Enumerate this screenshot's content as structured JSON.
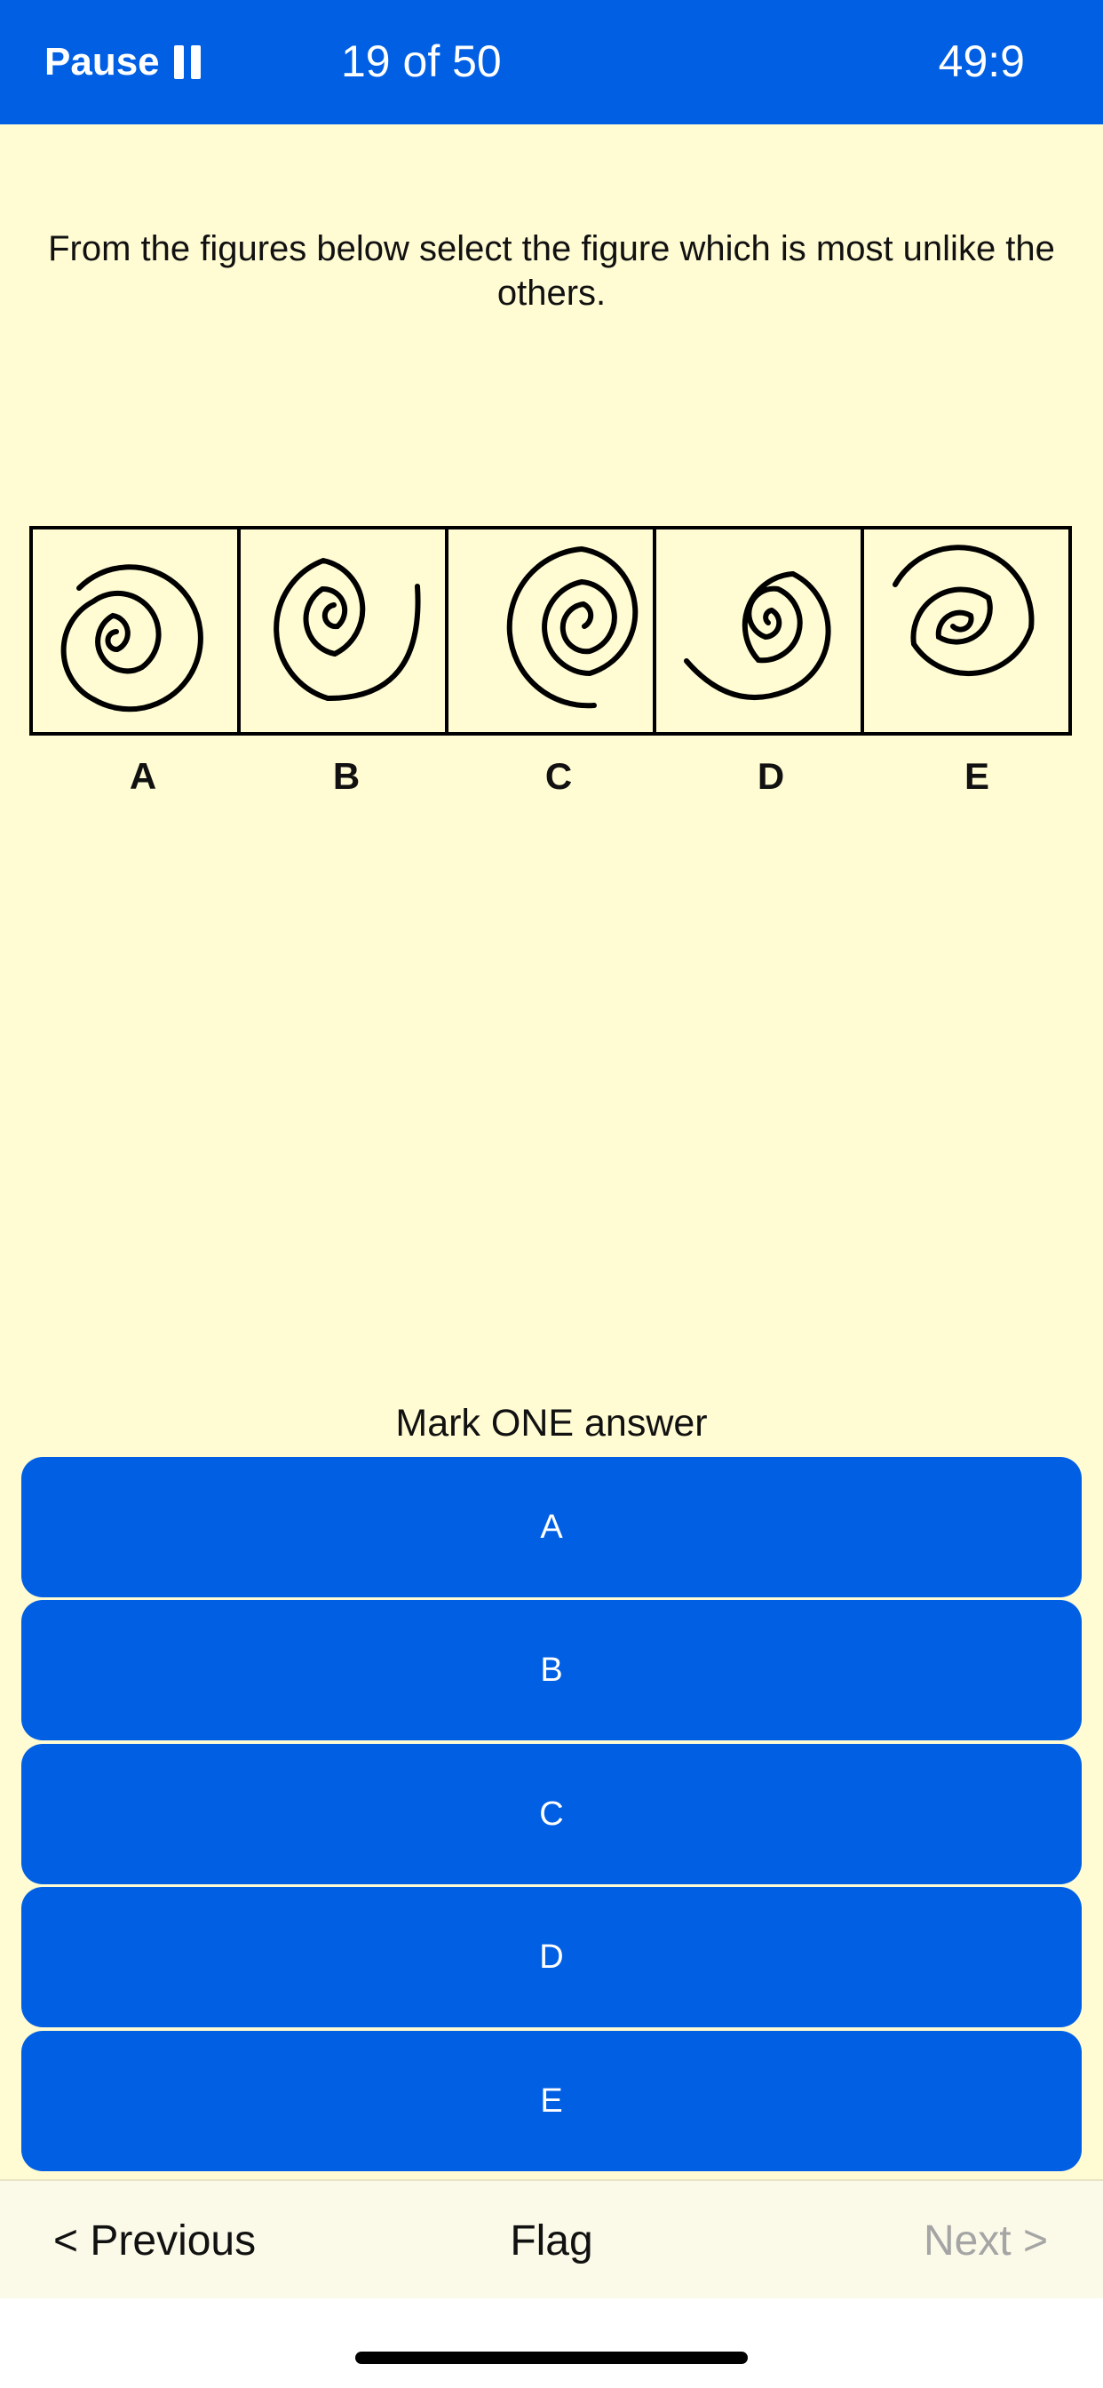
{
  "header": {
    "pause_label": "Pause",
    "progress_text": "19  of 50",
    "timer": "49:9"
  },
  "question": {
    "text": "From the figures below select the figure which is most unlike the others."
  },
  "figures": {
    "labels": [
      "A",
      "B",
      "C",
      "D",
      "E"
    ]
  },
  "answers": {
    "prompt": "Mark ONE answer",
    "options": [
      "A",
      "B",
      "C",
      "D",
      "E"
    ]
  },
  "footer": {
    "previous_label": "< Previous",
    "flag_label": "Flag",
    "next_label": "Next >"
  },
  "colors": {
    "accent": "#015FE4",
    "background": "#FFFBD3",
    "disabled_text": "#A5A5A5"
  }
}
